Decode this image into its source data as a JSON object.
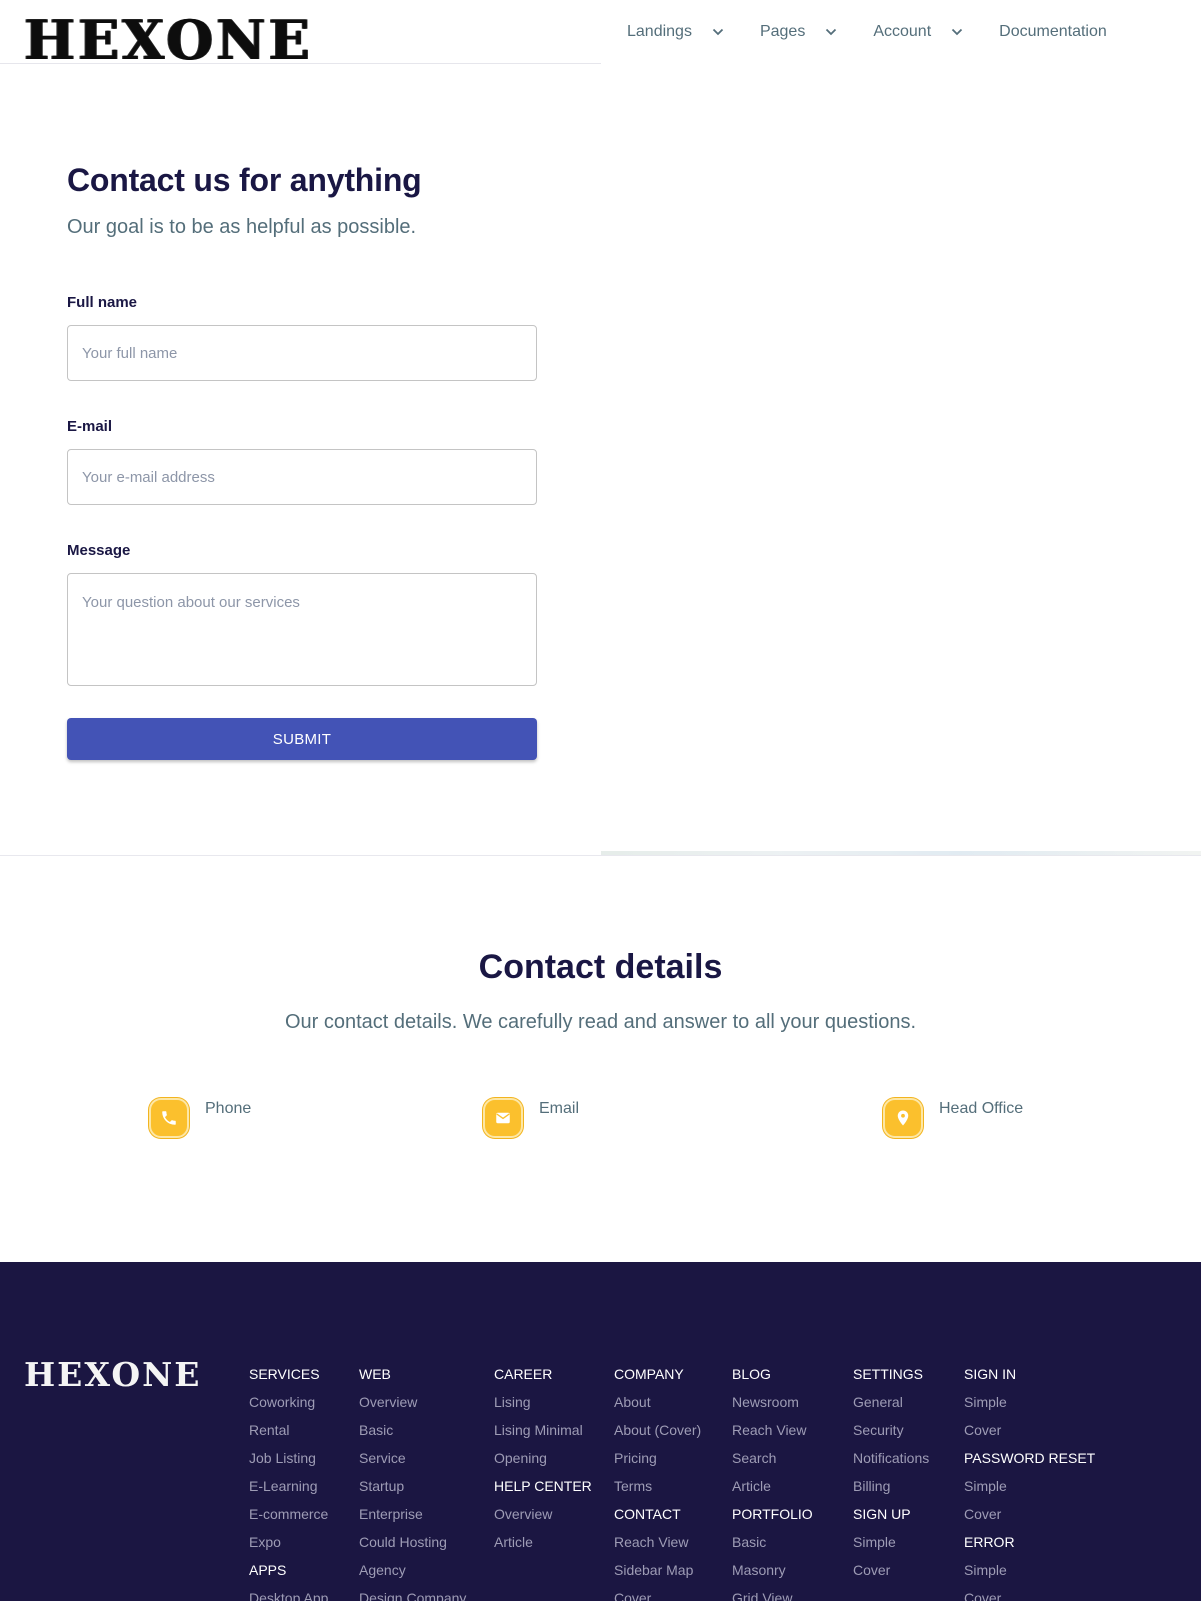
{
  "header": {
    "logo": "HEXONE",
    "nav": [
      {
        "label": "Landings",
        "dropdown": true
      },
      {
        "label": "Pages",
        "dropdown": true
      },
      {
        "label": "Account",
        "dropdown": true
      },
      {
        "label": "Documentation",
        "dropdown": false
      }
    ]
  },
  "form": {
    "title": "Contact us for anything",
    "subtitle": "Our goal is to be as helpful as possible.",
    "name_label": "Full name",
    "name_placeholder": "Your full name",
    "email_label": "E-mail",
    "email_placeholder": "Your e-mail address",
    "message_label": "Message",
    "message_placeholder": "Your question about our services",
    "submit_label": "SUBMIT"
  },
  "contact_details": {
    "title": "Contact details",
    "subtitle": "Our contact details. We carefully read and answer to all your questions.",
    "items": [
      {
        "label": "Phone",
        "icon": "phone-icon"
      },
      {
        "label": "Email",
        "icon": "envelope-icon"
      },
      {
        "label": "Head Office",
        "icon": "map-pin-icon"
      }
    ]
  },
  "footer": {
    "logo": "HEXONE",
    "columns": [
      [
        {
          "type": "heading",
          "text": "SERVICES"
        },
        {
          "type": "link",
          "text": "Coworking"
        },
        {
          "type": "link",
          "text": "Rental"
        },
        {
          "type": "link",
          "text": "Job Listing"
        },
        {
          "type": "link",
          "text": "E-Learning"
        },
        {
          "type": "link",
          "text": "E-commerce"
        },
        {
          "type": "link",
          "text": "Expo"
        },
        {
          "type": "heading",
          "text": "APPS"
        },
        {
          "type": "link",
          "text": "Desktop App"
        }
      ],
      [
        {
          "type": "heading",
          "text": "WEB"
        },
        {
          "type": "link",
          "text": "Overview"
        },
        {
          "type": "link",
          "text": "Basic"
        },
        {
          "type": "link",
          "text": "Service"
        },
        {
          "type": "link",
          "text": "Startup"
        },
        {
          "type": "link",
          "text": "Enterprise"
        },
        {
          "type": "link",
          "text": "Could Hosting"
        },
        {
          "type": "link",
          "text": "Agency"
        },
        {
          "type": "link",
          "text": "Design Company"
        }
      ],
      [
        {
          "type": "heading",
          "text": "CAREER"
        },
        {
          "type": "link",
          "text": "Lising"
        },
        {
          "type": "link",
          "text": "Lising Minimal"
        },
        {
          "type": "link",
          "text": "Opening"
        },
        {
          "type": "heading",
          "text": "HELP CENTER"
        },
        {
          "type": "link",
          "text": "Overview"
        },
        {
          "type": "link",
          "text": "Article"
        }
      ],
      [
        {
          "type": "heading",
          "text": "COMPANY"
        },
        {
          "type": "link",
          "text": "About"
        },
        {
          "type": "link",
          "text": "About (Cover)"
        },
        {
          "type": "link",
          "text": "Pricing"
        },
        {
          "type": "link",
          "text": "Terms"
        },
        {
          "type": "heading",
          "text": "CONTACT"
        },
        {
          "type": "link",
          "text": "Reach View"
        },
        {
          "type": "link",
          "text": "Sidebar Map"
        },
        {
          "type": "link",
          "text": "Cover"
        }
      ],
      [
        {
          "type": "heading",
          "text": "BLOG"
        },
        {
          "type": "link",
          "text": "Newsroom"
        },
        {
          "type": "link",
          "text": "Reach View"
        },
        {
          "type": "link",
          "text": "Search"
        },
        {
          "type": "link",
          "text": "Article"
        },
        {
          "type": "heading",
          "text": "PORTFOLIO"
        },
        {
          "type": "link",
          "text": "Basic"
        },
        {
          "type": "link",
          "text": "Masonry"
        },
        {
          "type": "link",
          "text": "Grid View"
        }
      ],
      [
        {
          "type": "heading",
          "text": "SETTINGS"
        },
        {
          "type": "link",
          "text": "General"
        },
        {
          "type": "link",
          "text": "Security"
        },
        {
          "type": "link",
          "text": "Notifications"
        },
        {
          "type": "link",
          "text": "Billing"
        },
        {
          "type": "heading",
          "text": "SIGN UP"
        },
        {
          "type": "link",
          "text": "Simple"
        },
        {
          "type": "link",
          "text": "Cover"
        }
      ],
      [
        {
          "type": "heading",
          "text": "SIGN IN"
        },
        {
          "type": "link",
          "text": "Simple"
        },
        {
          "type": "link",
          "text": "Cover"
        },
        {
          "type": "heading",
          "text": "PASSWORD RESET"
        },
        {
          "type": "link",
          "text": "Simple"
        },
        {
          "type": "link",
          "text": "Cover"
        },
        {
          "type": "heading",
          "text": "ERROR"
        },
        {
          "type": "link",
          "text": "Simple"
        },
        {
          "type": "link",
          "text": "Cover"
        }
      ]
    ]
  },
  "colors": {
    "primary": "#4353b6",
    "accent": "#fbc02d",
    "footer_bg": "#1b1642",
    "heading": "#1a1744",
    "muted": "#546e7a"
  }
}
